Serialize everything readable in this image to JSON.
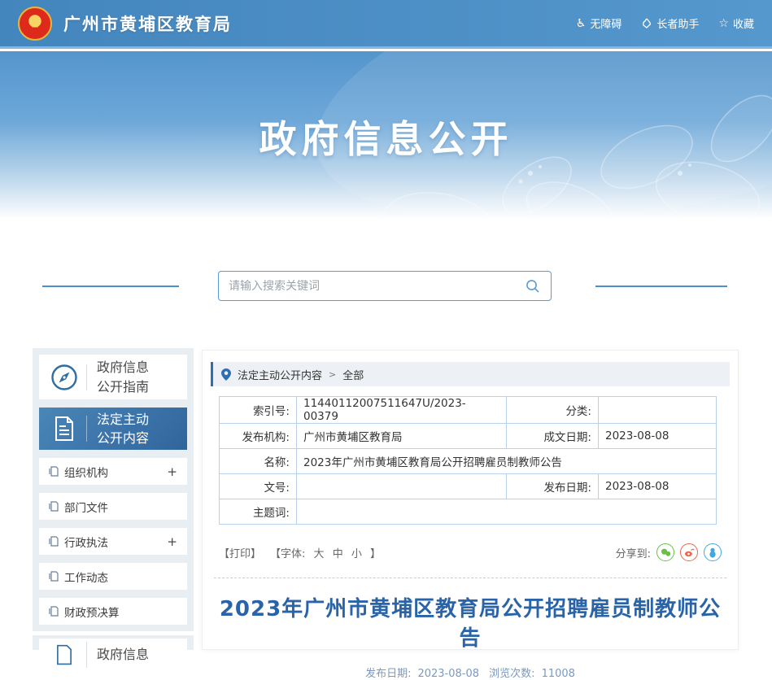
{
  "header": {
    "site_title": "广州市黄埔区教育局",
    "nav": {
      "accessibility": "无障碍",
      "elder_helper": "长者助手",
      "favorite": "收藏"
    }
  },
  "banner": {
    "title": "政府信息公开"
  },
  "search": {
    "placeholder": "请输入搜索关键词"
  },
  "sidebar": {
    "guide": {
      "line1": "政府信息",
      "line2": "公开指南"
    },
    "statutory": {
      "line1": "法定主动",
      "line2": "公开内容"
    },
    "items": [
      {
        "label": "组织机构",
        "expander": "+"
      },
      {
        "label": "部门文件",
        "expander": ""
      },
      {
        "label": "行政执法",
        "expander": "+"
      },
      {
        "label": "工作动态",
        "expander": ""
      },
      {
        "label": "财政预决算",
        "expander": ""
      }
    ],
    "partial": {
      "line1": "政府信息"
    }
  },
  "breadcrumb": {
    "root": "法定主动公开内容",
    "separator": ">",
    "current": "全部"
  },
  "meta_table": {
    "index_label": "索引号:",
    "index_value": "11440112007511647U/2023-00379",
    "category_label": "分类:",
    "category_value": "",
    "publisher_label": "发布机构:",
    "publisher_value": "广州市黄埔区教育局",
    "written_date_label": "成文日期:",
    "written_date_value": "2023-08-08",
    "name_label": "名称:",
    "name_value": "2023年广州市黄埔区教育局公开招聘雇员制教师公告",
    "doc_no_label": "文号:",
    "doc_no_value": "",
    "publish_date_label": "发布日期:",
    "publish_date_value": "2023-08-08",
    "keywords_label": "主题词:",
    "keywords_value": ""
  },
  "tools": {
    "print_label": "【打印】",
    "font_prefix": "【字体:",
    "font_large": "大",
    "font_medium": "中",
    "font_small": "小",
    "font_suffix": "】",
    "share_label": "分享到:"
  },
  "article": {
    "title": "2023年广州市黄埔区教育局公开招聘雇员制教师公告",
    "publish_date_label": "发布日期:",
    "publish_date": "2023-08-08",
    "views_label": "浏览次数:",
    "views": "11008"
  },
  "icons": {
    "accessibility": "wheelchair-icon",
    "elder_helper": "helping-hand-icon",
    "favorite": "star-icon",
    "search": "magnifier-icon",
    "guide": "compass-icon",
    "statutory": "document-icon",
    "breadcrumb": "location-pin-icon",
    "share": [
      "wechat-icon",
      "weibo-icon",
      "qq-icon"
    ]
  },
  "colors": {
    "accent": "#2f6db5",
    "header_blue": "#4385bd",
    "title_blue": "#2a64a8",
    "wechat_green": "#6abf47",
    "weibo_orange": "#e9664d",
    "qq_blue": "#45a6dd"
  }
}
